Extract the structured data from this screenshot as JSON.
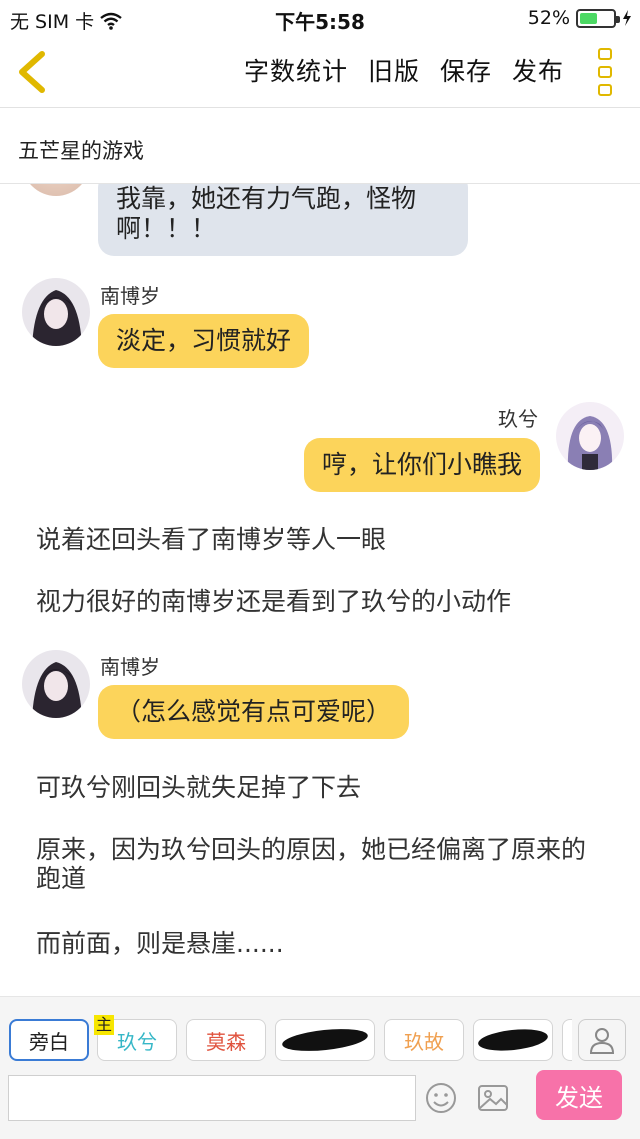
{
  "status_bar": {
    "carrier": "无 SIM 卡",
    "time": "下午5:58",
    "battery_percent": "52%",
    "battery_level": 0.52
  },
  "nav": {
    "actions": [
      "字数统计",
      "旧版",
      "保存",
      "发布"
    ],
    "accent_color": "#e0b800"
  },
  "title": "五芒星的游戏",
  "messages": [
    {
      "type": "bubble",
      "side": "left",
      "style": "grey",
      "speaker": "",
      "text": "我靠，她还有力气跑，怪物啊！！！"
    },
    {
      "type": "bubble",
      "side": "left",
      "style": "yellow",
      "speaker": "南博岁",
      "text": "淡定，习惯就好"
    },
    {
      "type": "bubble",
      "side": "right",
      "style": "yellow",
      "speaker": "玖兮",
      "text": "哼，让你们小瞧我"
    },
    {
      "type": "narration",
      "text": "说着还回头看了南博岁等人一眼"
    },
    {
      "type": "narration",
      "text": "视力很好的南博岁还是看到了玖兮的小动作"
    },
    {
      "type": "bubble",
      "side": "left",
      "style": "yellow",
      "speaker": "南博岁",
      "text": "（怎么感觉有点可爱呢）"
    },
    {
      "type": "narration",
      "text": "可玖兮刚回头就失足掉了下去"
    },
    {
      "type": "narration",
      "text": "原来，因为玖兮回头的原因，她已经偏离了原来的跑道"
    },
    {
      "type": "narration",
      "text": "而前面，则是悬崖......"
    }
  ],
  "bottom": {
    "role_chips": [
      {
        "label": "旁白",
        "color": "#222222"
      },
      {
        "label": "玖兮",
        "color": "#36b7c7"
      },
      {
        "label": "莫森",
        "color": "#e0533e"
      },
      {
        "label": "",
        "color": "#111111"
      },
      {
        "label": "玖故",
        "color": "#f0a050"
      },
      {
        "label": "",
        "color": "#111111"
      }
    ],
    "main_badge": "主",
    "input_value": "",
    "send_label": "发送",
    "send_color": "#f772a9"
  },
  "icons": [
    "chevron-left-icon",
    "more-vertical-icon",
    "wifi-icon",
    "charging-icon",
    "person-icon",
    "emoji-icon",
    "image-icon"
  ]
}
